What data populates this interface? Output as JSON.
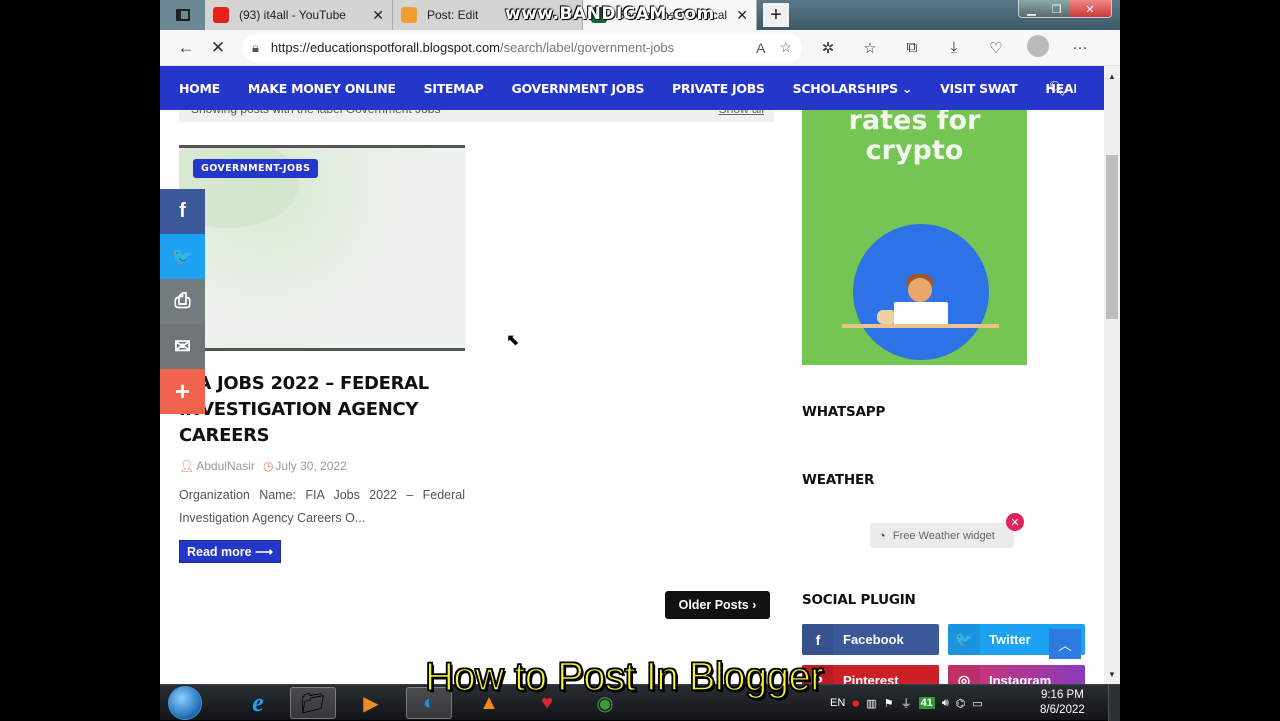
{
  "browser": {
    "tabs": [
      {
        "title": "(93) it4all - YouTube",
        "favicon": "youtube-icon",
        "color": "#e62117",
        "active": false
      },
      {
        "title": "Post: Edit",
        "favicon": "blogger-icon",
        "color": "#f0a030",
        "active": false
      },
      {
        "title": "Bacha Khan Medical Cor",
        "favicon": "pakistan-flag-icon",
        "color": "#0b6b2a",
        "active": true
      }
    ],
    "watermark": "www.BANDICAM.com",
    "url_host": "https://educationspotforall.blogspot.com",
    "url_path": "/search/label/government-jobs"
  },
  "nav": {
    "items": [
      "HOME",
      "MAKE MONEY ONLINE",
      "SITEMAP",
      "GOVERNMENT JOBS",
      "PRIVATE JOBS",
      "SCHOLARSHIPS",
      "VISIT SWAT",
      "HEALTH ARTICLES"
    ],
    "dropdown_marker": "⌄"
  },
  "status": {
    "label": "Showing posts with the label Government Jobs",
    "link": "Show all"
  },
  "post": {
    "badge": "GOVERNMENT-JOBS",
    "title": "FIA JOBS 2022 – FEDERAL INVESTIGATION AGENCY CAREERS",
    "author": "AbdulNasir",
    "date": "July 30, 2022",
    "excerpt": "Organization Name: FIA Jobs 2022 – Federal Investigation Agency Careers O...",
    "read_more": "Read more ⟶"
  },
  "older_posts": "Older Posts ›",
  "share": [
    {
      "name": "facebook",
      "glyph": "f",
      "color": "#3b5998"
    },
    {
      "name": "twitter",
      "glyph": "🐦",
      "color": "#1da1f2"
    },
    {
      "name": "print",
      "glyph": "⎙",
      "color": "#737b7e"
    },
    {
      "name": "email",
      "glyph": "✉",
      "color": "#6f7476"
    },
    {
      "name": "more",
      "glyph": "+",
      "color": "#f0634c"
    }
  ],
  "sidebar": {
    "ad_text_line1": "rates for",
    "ad_text_line2": "crypto",
    "ad_color": "#74c553",
    "whatsapp_title": "WHATSAPP",
    "weather_title": "WEATHER",
    "weather_widget": "Free Weather widget",
    "social_title": "SOCIAL PLUGIN",
    "social": [
      {
        "label": "Facebook",
        "glyph": "f",
        "color": "#3b5998"
      },
      {
        "label": "Twitter",
        "glyph": "🐦",
        "color": "#1da1f2"
      },
      {
        "label": "Pinterest",
        "glyph": "P",
        "color": "#cb2027"
      },
      {
        "label": "Instagram",
        "glyph": "◎",
        "color": "#b1399a"
      }
    ]
  },
  "caption": "How to Post In Blogger",
  "taskbar": {
    "lang": "EN",
    "time": "9:16 PM",
    "date": "8/6/2022",
    "tray_badge": "41"
  }
}
